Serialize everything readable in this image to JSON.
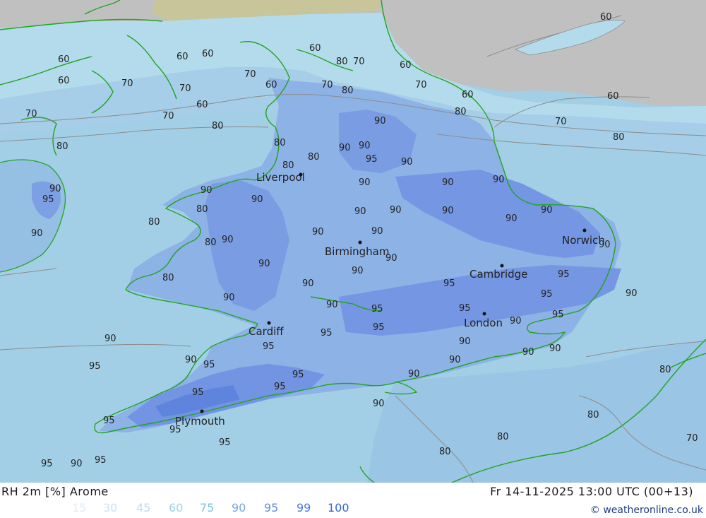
{
  "colors": {
    "bg_sea": "#9ec9e4",
    "land_grey": "#c0c0c0",
    "land_tan": "#c8c59a",
    "rh_60": "#b6dcec",
    "rh_75": "#a7d0ea",
    "rh_80": "#96bfe3",
    "rh_90": "#88aee6",
    "rh_95": "#6e92e2",
    "rh_99": "#5b7fde",
    "coast": "#1fa51f",
    "contour": "#8c8c8c",
    "label": "#222222"
  },
  "footer": {
    "title_left": "RH 2m [%] Arome",
    "title_right": "Fr 14-11-2025 13:00 UTC (00+13)",
    "credit": "© weatheronline.co.uk"
  },
  "legend": [
    {
      "value": "15",
      "color": "#e2ecf4"
    },
    {
      "value": "30",
      "color": "#d2e3f0"
    },
    {
      "value": "45",
      "color": "#c2daec"
    },
    {
      "value": "60",
      "color": "#9fd4ea"
    },
    {
      "value": "75",
      "color": "#7cc0e4"
    },
    {
      "value": "90",
      "color": "#78a6e0"
    },
    {
      "value": "95",
      "color": "#5f8ee0"
    },
    {
      "value": "99",
      "color": "#4a78dc"
    },
    {
      "value": "100",
      "color": "#3a64d6"
    }
  ],
  "cities": [
    {
      "name": "Liverpool"
    },
    {
      "name": "Birmingham"
    },
    {
      "name": "Norwich"
    },
    {
      "name": "Cambridge"
    },
    {
      "name": "London"
    },
    {
      "name": "Cardiff"
    },
    {
      "name": "Plymouth"
    }
  ],
  "contour_labels": [
    "60",
    "70",
    "80",
    "90",
    "95"
  ]
}
